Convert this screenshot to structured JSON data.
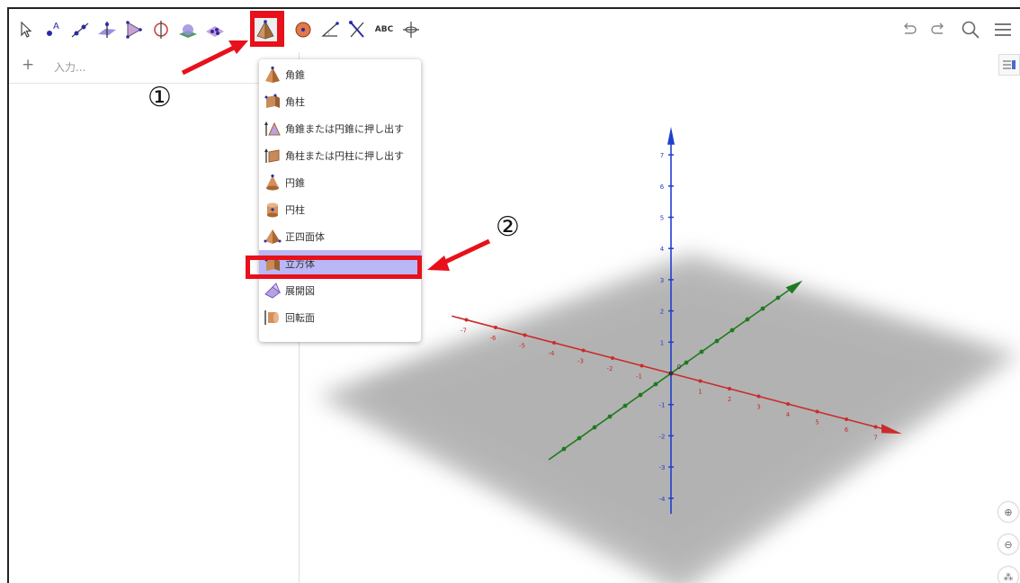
{
  "toolbar": {
    "tools": [
      {
        "name": "move-tool"
      },
      {
        "name": "point-tool"
      },
      {
        "name": "line-tool"
      },
      {
        "name": "perpendicular-tool"
      },
      {
        "name": "polygon-tool"
      },
      {
        "name": "circle-axis-tool"
      },
      {
        "name": "intersect-surface-tool"
      },
      {
        "name": "plane-tool"
      },
      {
        "name": "pyramid-tool",
        "selected": true
      },
      {
        "name": "sphere-tool"
      },
      {
        "name": "angle-tool"
      },
      {
        "name": "reflect-tool"
      },
      {
        "name": "text-tool",
        "label": "ABC"
      },
      {
        "name": "rotate-view-tool"
      }
    ],
    "right_icons": [
      "undo-icon",
      "redo-icon",
      "search-icon",
      "menu-icon"
    ]
  },
  "algebra": {
    "add_symbol": "+",
    "input_placeholder": "入力..."
  },
  "menu": {
    "items": [
      {
        "label": "角錐",
        "icon": "pyramid-icon"
      },
      {
        "label": "角柱",
        "icon": "prism-icon"
      },
      {
        "label": "角錐または円錐に押し出す",
        "icon": "extrude-pyramid-icon"
      },
      {
        "label": "角柱または円柱に押し出す",
        "icon": "extrude-prism-icon"
      },
      {
        "label": "円錐",
        "icon": "cone-icon"
      },
      {
        "label": "円柱",
        "icon": "cylinder-icon"
      },
      {
        "label": "正四面体",
        "icon": "tetrahedron-icon"
      },
      {
        "label": "立方体",
        "icon": "cube-icon",
        "highlighted": true
      },
      {
        "label": "展開図",
        "icon": "net-icon"
      },
      {
        "label": "回転面",
        "icon": "surface-revolution-icon"
      }
    ]
  },
  "annotations": {
    "step1": "①",
    "step2": "②"
  },
  "axes": {
    "x_neg": [
      "-7",
      "-6",
      "-5",
      "-4",
      "-3",
      "-2",
      "-1"
    ],
    "x_pos": [
      "1",
      "2",
      "3",
      "4",
      "5",
      "6",
      "7"
    ],
    "z_pos": [
      "1",
      "2",
      "3",
      "4",
      "5",
      "6",
      "7"
    ],
    "z_neg": [
      "-1",
      "-2",
      "-3",
      "-4"
    ],
    "origin": "0",
    "colors": {
      "x": "#cc2b2b",
      "y": "#1f7a1f",
      "z": "#1f3fcc",
      "accent": "#e8101a",
      "highlight": "#b9b7f6"
    }
  }
}
